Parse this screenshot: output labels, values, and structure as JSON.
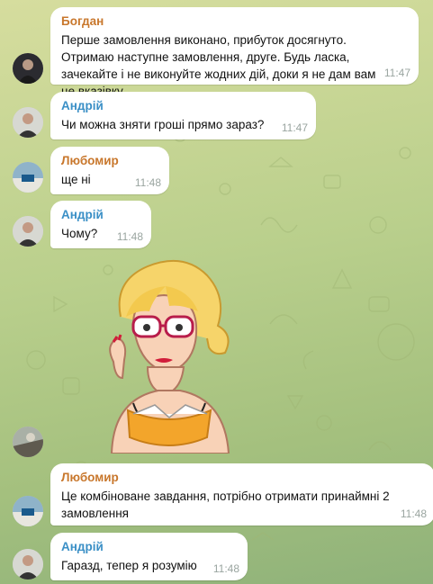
{
  "messages": [
    {
      "sender": "Богдан",
      "sender_color": "#c8772c",
      "text": "Перше замовлення виконано, прибуток досягнуто. Отримаю наступне замовлення, друге. Будь ласка, зачекайте і не виконуйте жодних дій, доки я не дам вам це вказівку",
      "time": "11:47"
    },
    {
      "sender": "Андрій",
      "sender_color": "#3a8fc6",
      "text": "Чи можна зняти гроші прямо зараз?",
      "time": "11:47"
    },
    {
      "sender": "Любомир",
      "sender_color": "#c8772c",
      "text": "ще ні",
      "time": "11:48"
    },
    {
      "sender": "Андрій",
      "sender_color": "#3a8fc6",
      "text": "Чому?",
      "time": "11:48"
    },
    {
      "sender": "Любомир",
      "sender_color": "#c8772c",
      "text": "Це комбіноване завдання, потрібно отримати принаймні 2 замовлення",
      "time": "11:48"
    },
    {
      "sender": "Андрій",
      "sender_color": "#3a8fc6",
      "text": "Гаразд, тепер я розумію",
      "time": "11:48"
    }
  ],
  "sticker": {
    "icon": "woman-with-glasses-sticker"
  }
}
